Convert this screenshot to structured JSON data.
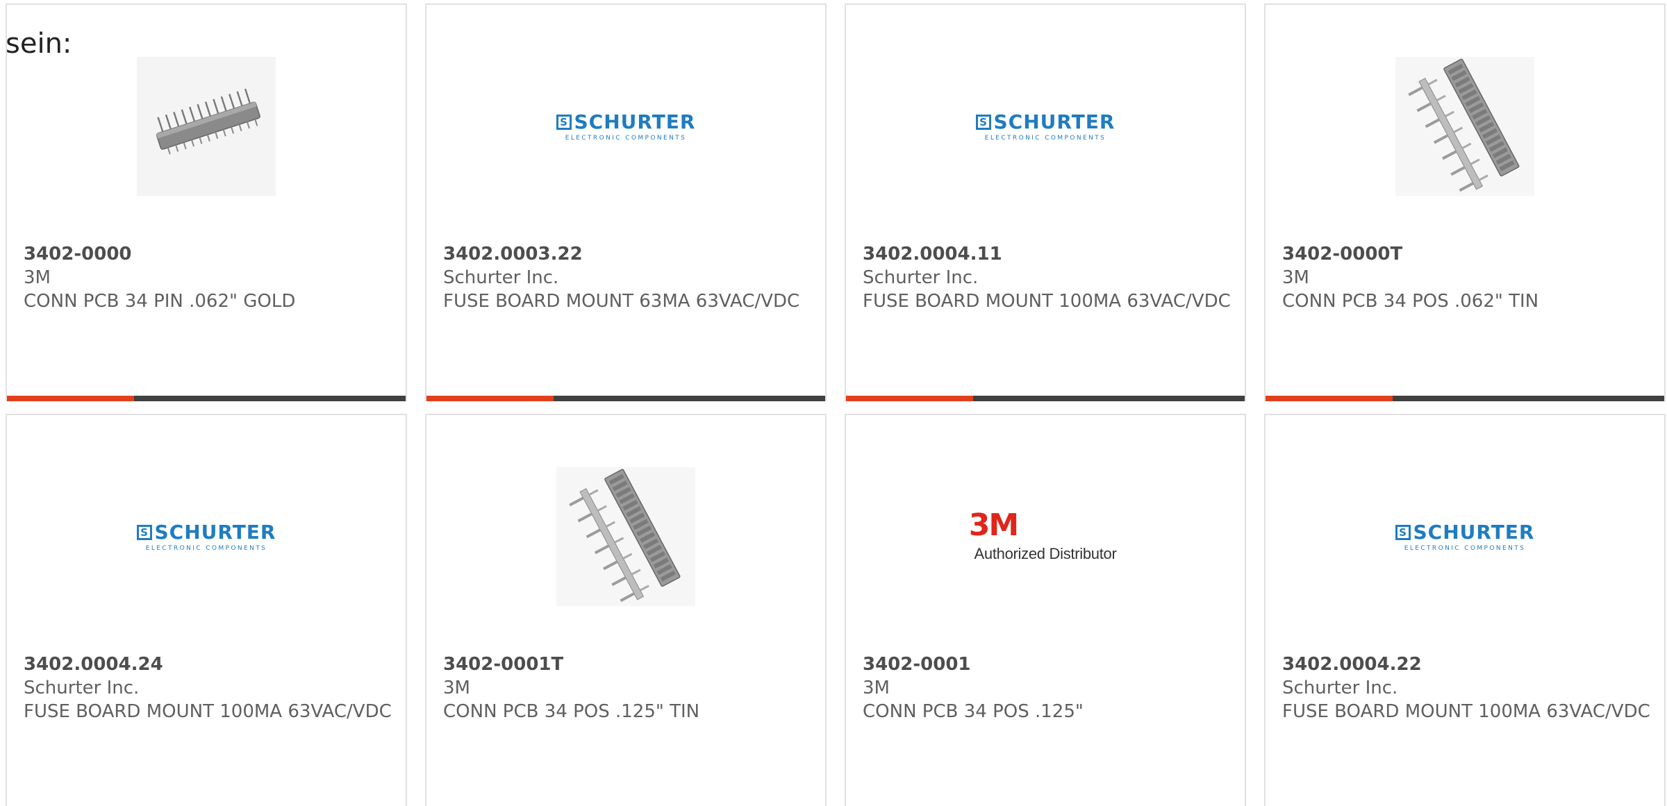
{
  "intro_text": "sein:",
  "colors": {
    "accent": "#e2401c",
    "bar": "#404040",
    "schurter_blue": "#1f7cc1",
    "mmm_red": "#e0261b"
  },
  "logos": {
    "schurter_word": "SCHURTER",
    "schurter_sub": "ELECTRONIC COMPONENTS",
    "schurter_s": "S",
    "mmm_word": "3M",
    "mmm_sub": "Authorized Distributor"
  },
  "products": [
    {
      "part": "3402-0000",
      "mfr": "3M",
      "desc": "CONN PCB 34 PIN .062\" GOLD",
      "image": "connector-straight"
    },
    {
      "part": "3402.0003.22",
      "mfr": "Schurter Inc.",
      "desc": "FUSE BOARD MOUNT 63MA 63VAC/VDC",
      "image": "schurter-logo"
    },
    {
      "part": "3402.0004.11",
      "mfr": "Schurter Inc.",
      "desc": "FUSE BOARD MOUNT 100MA 63VAC/VDC",
      "image": "schurter-logo"
    },
    {
      "part": "3402-0000T",
      "mfr": "3M",
      "desc": "CONN PCB 34 POS .062\" TIN",
      "image": "connector-angled"
    },
    {
      "part": "3402.0004.24",
      "mfr": "Schurter Inc.",
      "desc": "FUSE BOARD MOUNT 100MA 63VAC/VDC",
      "image": "schurter-logo"
    },
    {
      "part": "3402-0001T",
      "mfr": "3M",
      "desc": "CONN PCB 34 POS .125\" TIN",
      "image": "connector-angled"
    },
    {
      "part": "3402-0001",
      "mfr": "3M",
      "desc": "CONN PCB 34 POS .125\"",
      "image": "mmm-logo"
    },
    {
      "part": "3402.0004.22",
      "mfr": "Schurter Inc.",
      "desc": "FUSE BOARD MOUNT 100MA 63VAC/VDC",
      "image": "schurter-logo"
    }
  ]
}
